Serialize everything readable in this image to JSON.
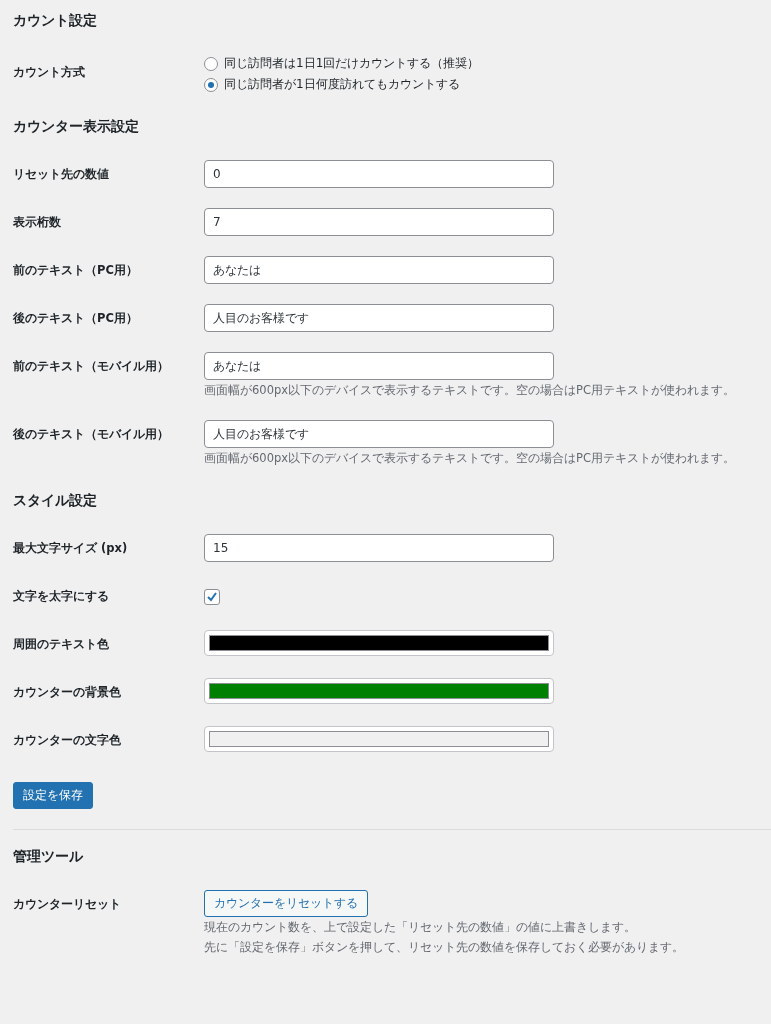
{
  "sections": [
    {
      "title": "カウント設定",
      "rows": [
        {
          "kind": "radio",
          "label": "カウント方式",
          "options": [
            {
              "label": "同じ訪問者は1日1回だけカウントする（推奨）",
              "selected": false
            },
            {
              "label": "同じ訪問者が1日何度訪れてもカウントする",
              "selected": true
            }
          ]
        }
      ]
    },
    {
      "title": "カウンター表示設定",
      "rows": [
        {
          "kind": "text",
          "label": "リセット先の数値",
          "value": "0"
        },
        {
          "kind": "text",
          "label": "表示桁数",
          "value": "7"
        },
        {
          "kind": "text",
          "label": "前のテキスト（PC用）",
          "value": "あなたは"
        },
        {
          "kind": "text",
          "label": "後のテキスト（PC用）",
          "value": "人目のお客様です"
        },
        {
          "kind": "text",
          "label": "前のテキスト（モバイル用）",
          "value": "あなたは",
          "description": [
            "画面幅が600px以下のデバイスで表示するテキストです。空の場合はPC用テキストが使われます。"
          ]
        },
        {
          "kind": "text",
          "label": "後のテキスト（モバイル用）",
          "value": "人目のお客様です",
          "description": [
            "画面幅が600px以下のデバイスで表示するテキストです。空の場合はPC用テキストが使われます。"
          ]
        }
      ]
    },
    {
      "title": "スタイル設定",
      "rows": [
        {
          "kind": "text",
          "label": "最大文字サイズ (px)",
          "value": "15"
        },
        {
          "kind": "checkbox",
          "label": "文字を太字にする",
          "checked": true
        },
        {
          "kind": "color",
          "label": "周囲のテキスト色",
          "color": "#000000"
        },
        {
          "kind": "color",
          "label": "カウンターの背景色",
          "color": "#008000"
        },
        {
          "kind": "color",
          "label": "カウンターの文字色",
          "color": "#f0f0f0"
        }
      ]
    }
  ],
  "save_button": "設定を保存",
  "tools": {
    "title": "管理ツール",
    "rows": [
      {
        "kind": "button",
        "label": "カウンターリセット",
        "button": "カウンターをリセットする",
        "description": [
          "現在のカウント数を、上で設定した「リセット先の数値」の値に上書きします。",
          "先に「設定を保存」ボタンを押して、リセット先の数値を保存しておく必要があります。"
        ]
      }
    ]
  }
}
